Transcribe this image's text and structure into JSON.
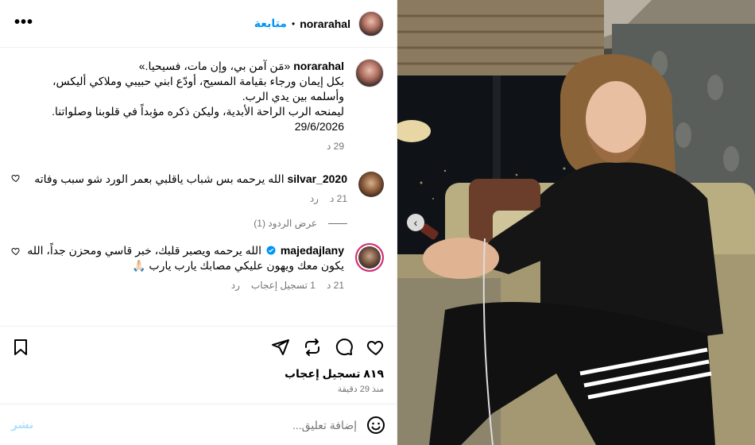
{
  "header": {
    "username": "norarahal",
    "separator": "•",
    "follow_label": "متابعة",
    "more_label": "•••"
  },
  "caption": {
    "username": "norarahal",
    "text_line1": "«مَن آمن بي، وإن مات، فسيحيا.»",
    "text_line2": "بكل إيمان ورجاء بقيامة المسيح، أودّع ابني حبيبي وملاكي أليكس،",
    "text_line3": "وأسلمه بين يدي الرب.",
    "text_line4": "ليمنحه الرب الراحة الأبدية، وليكن ذكره مؤبداً في قلوبنا وصلواتنا.",
    "text_line5": "29/6/2026",
    "time": "29 د"
  },
  "comments": [
    {
      "username": "silvar_2020",
      "text": "الله يرحمه بس شباب ياقلبي بعمر الورد شو سبب وفاته",
      "time": "21 د",
      "reply_label": "رد",
      "view_replies": "عرض الردود (1)"
    },
    {
      "username": "majedajlany",
      "verified": true,
      "text": "الله يرحمه ويصبر قلبك، خبر قاسي ومحزن جداً، الله يكون معك ويهون عليكي مصابك يارب يارب 🙏🏻",
      "time": "21 د",
      "likes": "1 تسجيل إعجاب",
      "reply_label": "رد"
    }
  ],
  "actions": {
    "like_count": "٨١٩ تسجيل إعجاب",
    "posted_ago": "منذ 29 دقيقة"
  },
  "add_comment": {
    "placeholder": "إضافة تعليق...",
    "post_label": "نشر"
  },
  "colors": {
    "link_blue": "#0095f6",
    "muted": "#737373",
    "post_disabled": "#b2dffc",
    "verified": "#0095f6"
  },
  "icons": {
    "more": "more-icon",
    "heart": "heart-icon",
    "comment": "comment-icon",
    "share": "share-icon",
    "repost": "repost-icon",
    "save": "bookmark-icon",
    "emoji": "emoji-icon",
    "prev": "chevron-left-icon"
  }
}
